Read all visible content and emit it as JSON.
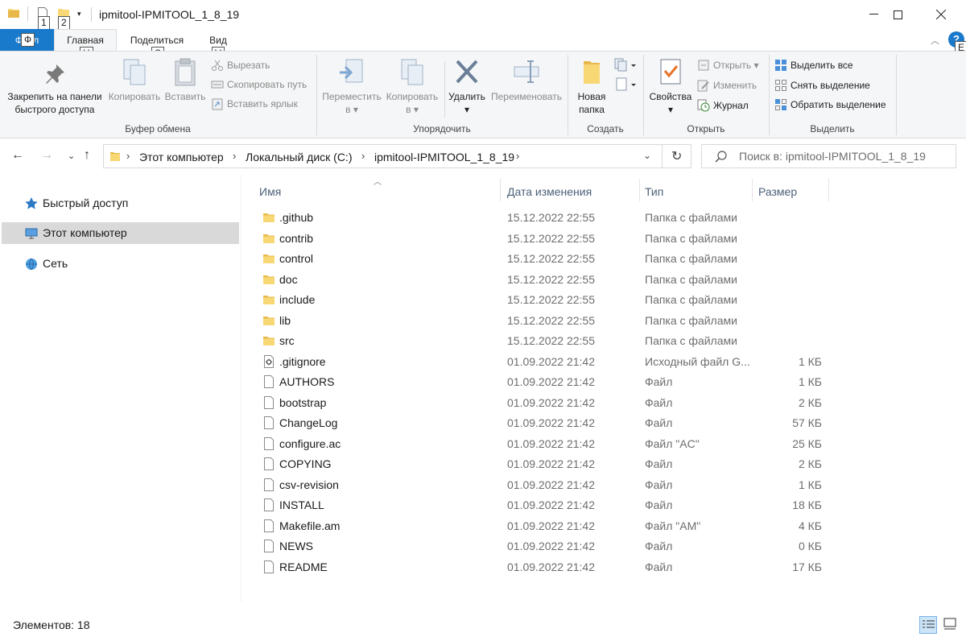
{
  "window": {
    "title": "ipmitool-IPMITOOL_1_8_19",
    "keytips": [
      "1",
      "2",
      "H",
      "S",
      "V",
      "E"
    ]
  },
  "ribbon_tabs": {
    "file": "Файл",
    "home": "Главная",
    "share": "Поделиться",
    "view": "Вид"
  },
  "ribbon": {
    "clipboard": {
      "label": "Буфер обмена",
      "pin": "Закрепить на панели быстрого доступа",
      "pin_l1": "Закрепить на панели",
      "pin_l2": "быстрого доступа",
      "copy": "Копировать",
      "paste": "Вставить",
      "cut": "Вырезать",
      "copy_path": "Скопировать путь",
      "paste_shortcut": "Вставить ярлык"
    },
    "organize": {
      "label": "Упорядочить",
      "move_l1": "Переместить",
      "move_l2": "в",
      "copy_l1": "Копировать",
      "copy_l2": "в",
      "delete": "Удалить",
      "rename": "Переименовать"
    },
    "create": {
      "label": "Создать",
      "new_folder_l1": "Новая",
      "new_folder_l2": "папка"
    },
    "open": {
      "label": "Открыть",
      "properties": "Свойства",
      "open": "Открыть",
      "edit": "Изменить",
      "history": "Журнал"
    },
    "select": {
      "label": "Выделить",
      "select_all": "Выделить все",
      "select_none": "Снять выделение",
      "invert": "Обратить выделение"
    }
  },
  "address": {
    "crumbs": [
      "Этот компьютер",
      "Локальный диск (C:)",
      "ipmitool-IPMITOOL_1_8_19"
    ]
  },
  "search": {
    "placeholder": "Поиск в: ipmitool-IPMITOOL_1_8_19"
  },
  "sidebar": {
    "items": [
      {
        "label": "Быстрый доступ"
      },
      {
        "label": "Этот компьютер"
      },
      {
        "label": "Сеть"
      }
    ]
  },
  "columns": {
    "name": "Имя",
    "date": "Дата изменения",
    "type": "Тип",
    "size": "Размер"
  },
  "files": [
    {
      "name": ".github",
      "date": "15.12.2022 22:55",
      "type": "Папка с файлами",
      "size": "",
      "kind": "folder"
    },
    {
      "name": "contrib",
      "date": "15.12.2022 22:55",
      "type": "Папка с файлами",
      "size": "",
      "kind": "folder"
    },
    {
      "name": "control",
      "date": "15.12.2022 22:55",
      "type": "Папка с файлами",
      "size": "",
      "kind": "folder"
    },
    {
      "name": "doc",
      "date": "15.12.2022 22:55",
      "type": "Папка с файлами",
      "size": "",
      "kind": "folder"
    },
    {
      "name": "include",
      "date": "15.12.2022 22:55",
      "type": "Папка с файлами",
      "size": "",
      "kind": "folder"
    },
    {
      "name": "lib",
      "date": "15.12.2022 22:55",
      "type": "Папка с файлами",
      "size": "",
      "kind": "folder"
    },
    {
      "name": "src",
      "date": "15.12.2022 22:55",
      "type": "Папка с файлами",
      "size": "",
      "kind": "folder"
    },
    {
      "name": ".gitignore",
      "date": "01.09.2022 21:42",
      "type": "Исходный файл G...",
      "size": "1 КБ",
      "kind": "settings-file"
    },
    {
      "name": "AUTHORS",
      "date": "01.09.2022 21:42",
      "type": "Файл",
      "size": "1 КБ",
      "kind": "file"
    },
    {
      "name": "bootstrap",
      "date": "01.09.2022 21:42",
      "type": "Файл",
      "size": "2 КБ",
      "kind": "file"
    },
    {
      "name": "ChangeLog",
      "date": "01.09.2022 21:42",
      "type": "Файл",
      "size": "57 КБ",
      "kind": "file"
    },
    {
      "name": "configure.ac",
      "date": "01.09.2022 21:42",
      "type": "Файл \"AC\"",
      "size": "25 КБ",
      "kind": "file"
    },
    {
      "name": "COPYING",
      "date": "01.09.2022 21:42",
      "type": "Файл",
      "size": "2 КБ",
      "kind": "file"
    },
    {
      "name": "csv-revision",
      "date": "01.09.2022 21:42",
      "type": "Файл",
      "size": "1 КБ",
      "kind": "file"
    },
    {
      "name": "INSTALL",
      "date": "01.09.2022 21:42",
      "type": "Файл",
      "size": "18 КБ",
      "kind": "file"
    },
    {
      "name": "Makefile.am",
      "date": "01.09.2022 21:42",
      "type": "Файл \"AM\"",
      "size": "4 КБ",
      "kind": "file"
    },
    {
      "name": "NEWS",
      "date": "01.09.2022 21:42",
      "type": "Файл",
      "size": "0 КБ",
      "kind": "file"
    },
    {
      "name": "README",
      "date": "01.09.2022 21:42",
      "type": "Файл",
      "size": "17 КБ",
      "kind": "file"
    }
  ],
  "status": {
    "count": "Элементов: 18"
  },
  "colors": {
    "accent": "#1979ca",
    "folder": "#f8d775",
    "selected": "#d9d9d9"
  }
}
